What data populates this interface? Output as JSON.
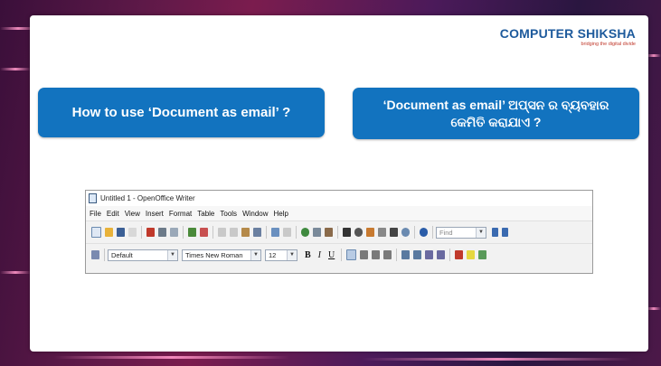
{
  "logo": {
    "name": "COMPUTER SHIKSHA",
    "tagline": "bridging the digital divide"
  },
  "question_english": "How to use ‘Document as email’ ?",
  "question_odia": {
    "line1": "‘Document as email’ ଅପ୍ସନ ର ବ୍ୟବହାର",
    "line2": "କେମିତି କରାଯାଏ ?"
  },
  "writer": {
    "title": "Untitled 1 - OpenOffice Writer",
    "menu": [
      "File",
      "Edit",
      "View",
      "Insert",
      "Format",
      "Table",
      "Tools",
      "Window",
      "Help"
    ],
    "find_placeholder": "Find",
    "paragraph_style": "Default",
    "font_name": "Times New Roman",
    "font_size": "12",
    "bold": "B",
    "italic": "I",
    "underline": "U"
  },
  "colors": {
    "accent": "#1273bf",
    "logo": "#1d5a9c",
    "background": "#5e1948"
  }
}
